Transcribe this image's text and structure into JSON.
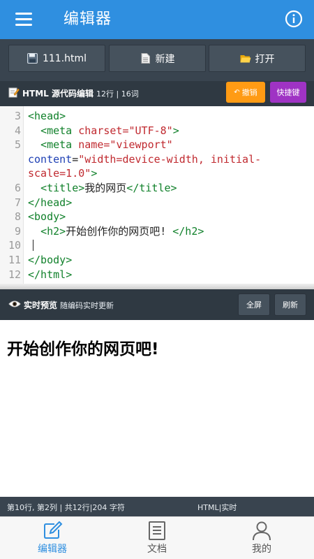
{
  "appbar": {
    "title": "编辑器",
    "menu_icon": "hamburger-menu-icon",
    "info_icon": "info-circle-icon"
  },
  "toolbar": {
    "file_label": "111.html",
    "new_label": "新建",
    "open_label": "打开"
  },
  "editor_header": {
    "title": "HTML 源代码编辑",
    "meta": "12行 | 16词",
    "undo_label": "撤销",
    "shortcut_label": "快捷键"
  },
  "code": {
    "lines": [
      {
        "n": "3",
        "text": "<head>"
      },
      {
        "n": "4",
        "text": "  <meta charset=\"UTF-8\">"
      },
      {
        "n": "5",
        "text": "  <meta name=\"viewport\""
      },
      {
        "n": "",
        "text": "content=\"width=device-width, initial-"
      },
      {
        "n": "",
        "text": "scale=1.0\">"
      },
      {
        "n": "6",
        "text": "  <title>我的网页</title>"
      },
      {
        "n": "7",
        "text": "</head>"
      },
      {
        "n": "8",
        "text": "<body>"
      },
      {
        "n": "9",
        "text": "  <h2>开始创作你的网页吧! </h2>"
      },
      {
        "n": "10",
        "text": ""
      },
      {
        "n": "11",
        "text": "</body>"
      },
      {
        "n": "12",
        "text": "</html>"
      }
    ]
  },
  "preview_header": {
    "title": "实时预览",
    "meta": "随编码实时更新",
    "fullscreen_label": "全屏",
    "refresh_label": "刷新"
  },
  "preview": {
    "heading": "开始创作你的网页吧!"
  },
  "status": {
    "left": "第10行, 第2列 | 共12行|204 字符",
    "right": "HTML|实时"
  },
  "bottom_nav": {
    "items": [
      {
        "label": "编辑器",
        "icon": "edit-icon",
        "active": true
      },
      {
        "label": "文档",
        "icon": "document-icon",
        "active": false
      },
      {
        "label": "我的",
        "icon": "user-icon",
        "active": false
      }
    ]
  },
  "colors": {
    "primary": "#2f8fe0",
    "dark": "#39444f",
    "undo": "#ff9b14",
    "shortcut": "#9f33c4",
    "tag": "#11812b",
    "attr": "#1e40b4",
    "string": "#c0292f"
  }
}
